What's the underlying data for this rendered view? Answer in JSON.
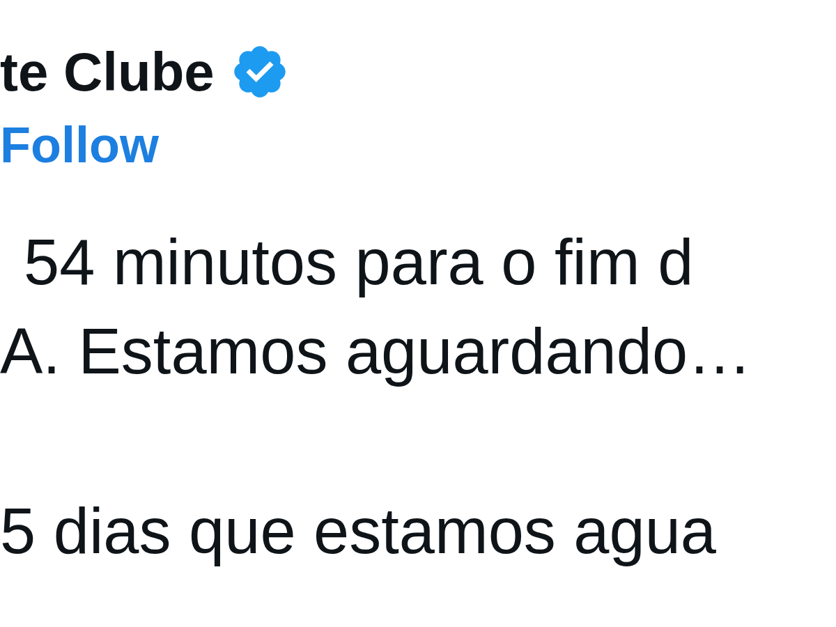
{
  "author": {
    "name": "te Clube",
    "verified": true,
    "follow": "Follow"
  },
  "tweet": {
    "paragraphs": [
      {
        "lines": [
          "54 minutos para o fim d",
          "A. Estamos aguardando…"
        ]
      },
      {
        "lines": [
          "5 dias que estamos agua"
        ]
      }
    ]
  }
}
